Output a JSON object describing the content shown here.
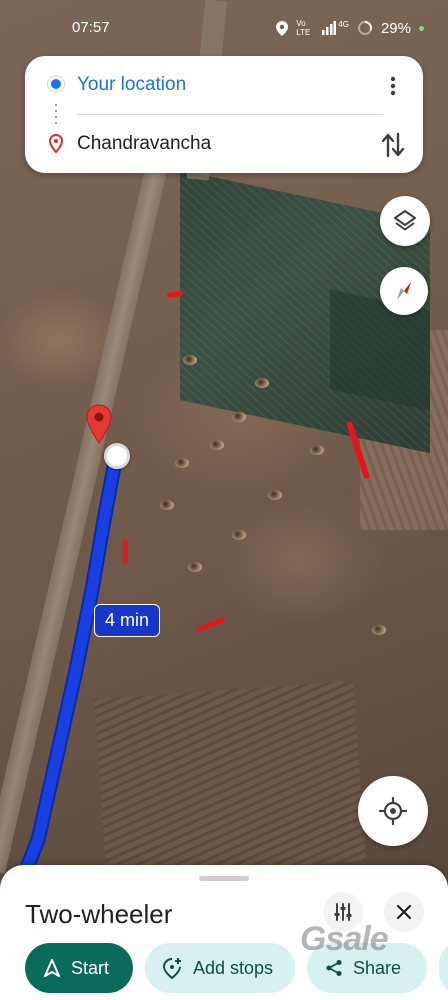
{
  "status_bar": {
    "time": "07:57",
    "net_label": "Vo LTE",
    "net_label2": "4G",
    "battery": "29%"
  },
  "search_card": {
    "origin": "Your location",
    "destination": "Chandravancha"
  },
  "map": {
    "eta_label": "4 min"
  },
  "sheet": {
    "mode_title": "Two-wheeler",
    "start_label": "Start",
    "add_stops_label": "Add stops",
    "share_label": "Share"
  },
  "watermark": "Gsale",
  "colors": {
    "route": "#1a3fe0",
    "primary": "#1a73e8",
    "start_button": "#0b6b5a",
    "chip_bg": "#d6f1ef"
  }
}
